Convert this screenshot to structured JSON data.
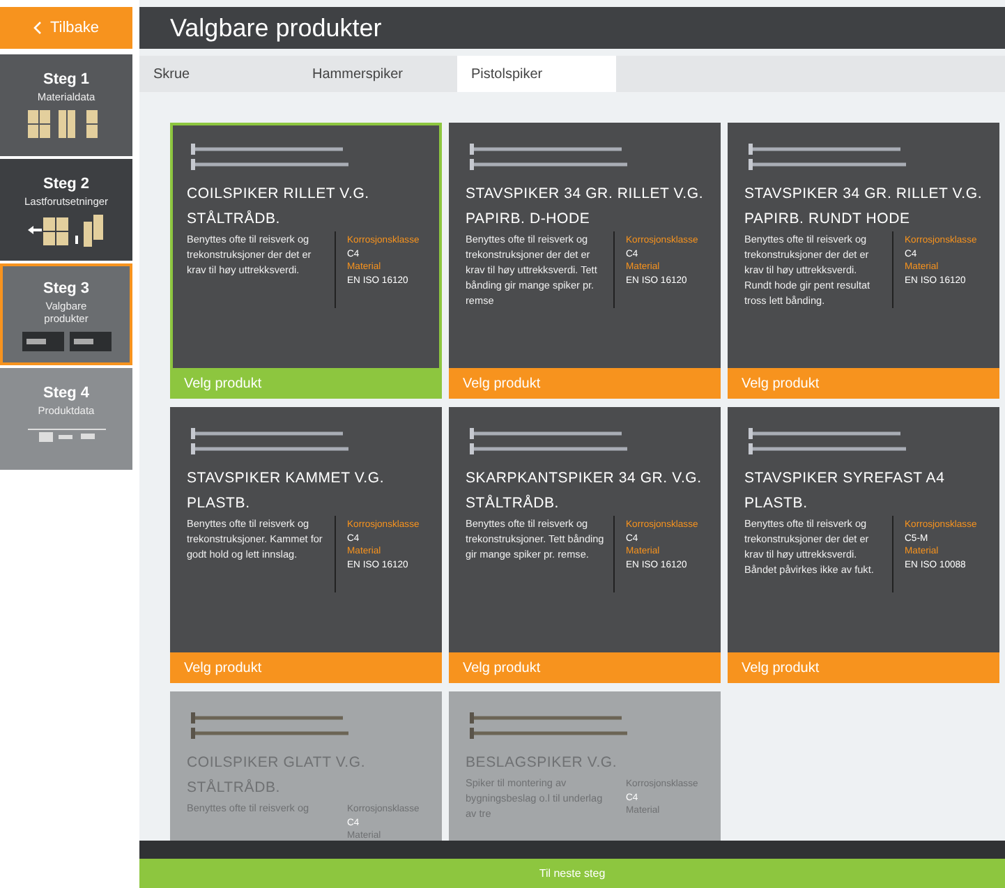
{
  "back_button": {
    "label": "Tilbake"
  },
  "steps": [
    {
      "title": "Steg 1",
      "subtitle": "Materialdata",
      "selected": false,
      "color": "#56585b"
    },
    {
      "title": "Steg 2",
      "subtitle": "Lastforutsetninger",
      "selected": false,
      "color": "#3d3f42"
    },
    {
      "title": "Steg 3",
      "subtitle": "Valgbare produkter",
      "selected": true,
      "color": "#6a6d70"
    },
    {
      "title": "Steg 4",
      "subtitle": "Produktdata",
      "selected": false,
      "color": "#8b8e91"
    }
  ],
  "page_title": "Valgbare produkter",
  "tabs": [
    {
      "label": "Skrue",
      "selected": false
    },
    {
      "label": "Hammerspiker",
      "selected": false
    },
    {
      "label": "Pistolspiker",
      "selected": true
    }
  ],
  "products": [
    {
      "name": "COILSPIKER RILLET V.G. STÅLTRÅDB.",
      "description": "Benyttes ofte til reisverk og trekonstruksjoner der det er krav til høy uttrekksverdi.",
      "class_label": "Korrosjonsklasse",
      "class_value": "C4",
      "material_label": "Material",
      "material_value": "EN ISO 16120",
      "button": "Velg produkt",
      "selected": true,
      "disabled": false
    },
    {
      "name": "STAVSPIKER 34 GR. RILLET V.G. PAPIRB. D-HODE",
      "description": "Benyttes ofte til reisverk og trekonstruksjoner der det er krav til høy uttrekksverdi. Tett bånding gir mange spiker pr. remse",
      "class_label": "Korrosjonsklasse",
      "class_value": "C4",
      "material_label": "Material",
      "material_value": "EN ISO 16120",
      "button": "Velg produkt",
      "selected": false,
      "disabled": false
    },
    {
      "name": "STAVSPIKER 34 GR. RILLET V.G. PAPIRB. RUNDT HODE",
      "description": "Benyttes ofte til reisverk og trekonstruksjoner der det er krav til høy uttrekksverdi. Rundt hode gir pent resultat tross lett bånding.",
      "class_label": "Korrosjonsklasse",
      "class_value": "C4",
      "material_label": "Material",
      "material_value": "EN ISO 16120",
      "button": "Velg produkt",
      "selected": false,
      "disabled": false
    },
    {
      "name": "STAVSPIKER KAMMET V.G. PLASTB.",
      "description": "Benyttes ofte til reisverk og trekonstruksjoner. Kammet for godt hold og lett innslag.",
      "class_label": "Korrosjonsklasse",
      "class_value": "C4",
      "material_label": "Material",
      "material_value": "EN ISO 16120",
      "button": "Velg produkt",
      "selected": false,
      "disabled": false
    },
    {
      "name": "SKARPKANTSPIKER 34 GR. V.G. STÅLTRÅDB.",
      "description": "Benyttes ofte til reisverk og trekonstruksjoner. Tett bånding gir mange spiker pr. remse.",
      "class_label": "Korrosjonsklasse",
      "class_value": "C4",
      "material_label": "Material",
      "material_value": "EN ISO 16120",
      "button": "Velg produkt",
      "selected": false,
      "disabled": false
    },
    {
      "name": "STAVSPIKER SYREFAST A4 PLASTB.",
      "description": "Benyttes ofte til reisverk og trekonstruksjoner der det er krav til høy uttrekksverdi. Båndet påvirkes ikke av fukt.",
      "class_label": "Korrosjonsklasse",
      "class_value": "C5-M",
      "material_label": "Material",
      "material_value": "EN ISO 10088",
      "button": "Velg produkt",
      "selected": false,
      "disabled": false
    },
    {
      "name": "COILSPIKER GLATT V.G. STÅLTRÅDB.",
      "description": "Benyttes ofte til reisverk og",
      "class_label": "Korrosjonsklasse",
      "class_value": "C4",
      "material_label": "Material",
      "selected": false,
      "disabled": true
    },
    {
      "name": "BESLAGSPIKER V.G.",
      "description": "Spiker til montering av bygningsbeslag o.l til underlag av tre",
      "class_label": "Korrosjonsklasse",
      "class_value": "C4",
      "material_label": "Material",
      "selected": false,
      "disabled": true
    }
  ],
  "next_button": {
    "label": "Til neste steg"
  }
}
